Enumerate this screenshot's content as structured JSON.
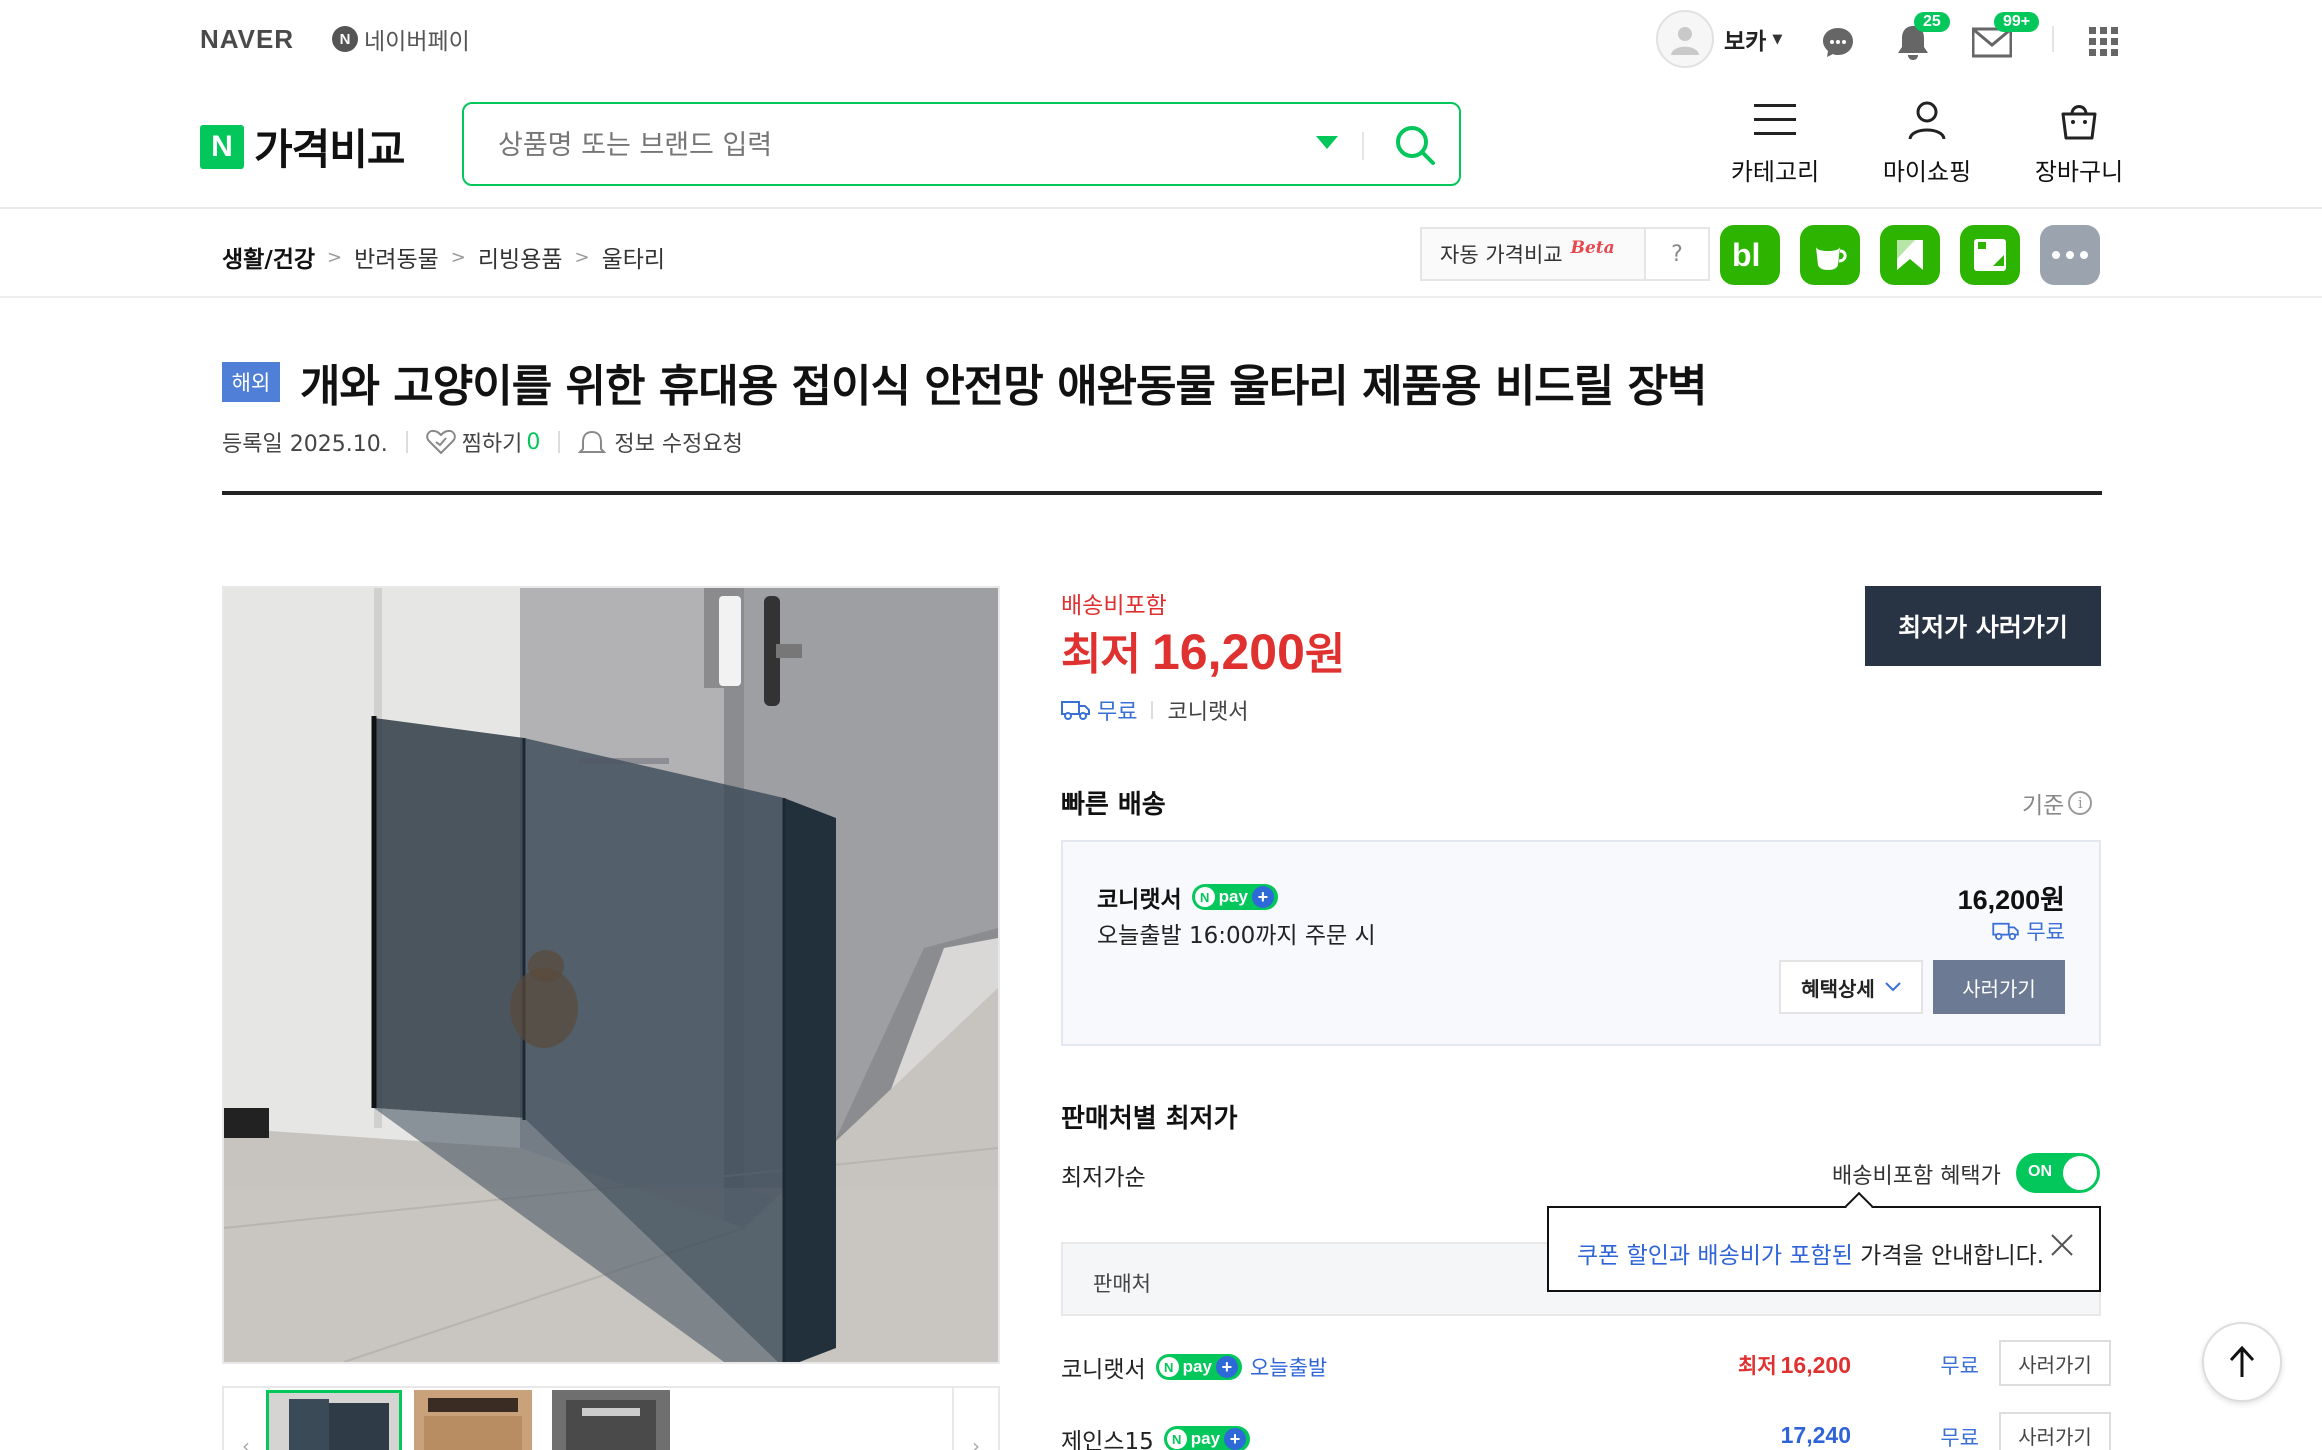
{
  "topbar": {
    "naver_logo": "NAVER",
    "npay_link": "네이버페이",
    "user_name": "보카",
    "notification_count": "25",
    "mail_count": "99+"
  },
  "header": {
    "brand_letter": "N",
    "brand_text": "가격비교",
    "search_placeholder": "상품명 또는 브랜드 입력",
    "menu": {
      "category": "카테고리",
      "myshopping": "마이쇼핑",
      "cart": "장바구니"
    }
  },
  "breadcrumb": [
    "생활/건강",
    "반려동물",
    "리빙용품",
    "울타리"
  ],
  "auto_compare": {
    "label": "자동 가격비교",
    "beta": "Beta",
    "help": "?"
  },
  "product": {
    "badge": "해외",
    "title": "개와 고양이를 위한 휴대용 접이식 안전망 애완동물 울타리 제품용 비드릴 장벽",
    "registered": "등록일 2025.10.",
    "wish_label": "찜하기",
    "wish_count": "0",
    "edit_request": "정보 수정요청"
  },
  "price": {
    "shipping_included": "배송비포함",
    "lowest_label": "최저",
    "lowest_value": "16,200",
    "currency": "원",
    "shipping": "무료",
    "seller": "코니랫서",
    "buy_lowest_button": "최저가 사러가기"
  },
  "fast_delivery": {
    "title": "빠른 배송",
    "criteria": "기준",
    "seller": "코니랫서",
    "npay": "pay",
    "dispatch": "오늘출발 16:00까지 주문 시",
    "price": "16,200",
    "currency": "원",
    "shipping": "무료",
    "benefit_button": "혜택상세",
    "buy_button": "사러가기"
  },
  "seller_list": {
    "title": "판매처별 최저가",
    "sort_label": "최저가순",
    "toggle_label": "배송비포함 혜택가",
    "toggle_state": "ON",
    "column_seller": "판매처",
    "tooltip_highlight": "쿠폰 할인과 배송비가 포함된",
    "tooltip_rest": " 가격을 안내합니다.",
    "rows": [
      {
        "seller": "코니랫서",
        "npay": "pay",
        "today": "오늘출발",
        "price_prefix": "최저",
        "price": "16,200",
        "shipping": "무료",
        "buy": "사러가기"
      },
      {
        "seller": "제인스15",
        "npay": "pay",
        "today": "",
        "price_prefix": "",
        "price": "17,240",
        "shipping": "무료",
        "buy": "사러가기"
      }
    ]
  },
  "colors": {
    "brand_green": "#03c75a",
    "price_red": "#e03131",
    "link_blue": "#2f64d8",
    "dark_button": "#283344"
  }
}
